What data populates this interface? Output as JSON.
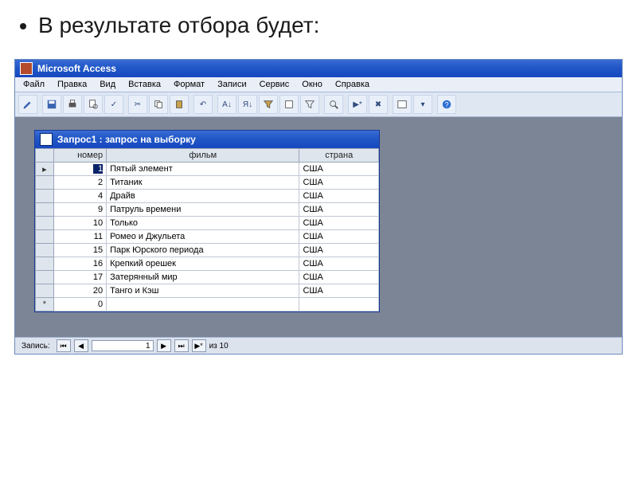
{
  "slide": {
    "bullet": "В результате отбора будет:"
  },
  "app": {
    "title": "Microsoft Access",
    "menu": [
      "Файл",
      "Правка",
      "Вид",
      "Вставка",
      "Формат",
      "Записи",
      "Сервис",
      "Окно",
      "Справка"
    ]
  },
  "toolbar_icons": [
    "design-view",
    "save",
    "print",
    "print-preview",
    "spelling",
    "cut",
    "copy",
    "paste",
    "undo",
    "sort-asc",
    "sort-desc",
    "filter-by-selection",
    "filter-by-form",
    "apply-filter",
    "find",
    "new-record",
    "delete-record",
    "database-window",
    "new-object",
    "help"
  ],
  "child": {
    "title": "Запрос1 : запрос на выборку"
  },
  "columns": {
    "num": "номер",
    "film": "фильм",
    "country": "страна"
  },
  "rows": [
    {
      "num": 1,
      "film": "Пятый элемент",
      "country": "США"
    },
    {
      "num": 2,
      "film": "Титаник",
      "country": "США"
    },
    {
      "num": 4,
      "film": "Драйв",
      "country": "США"
    },
    {
      "num": 9,
      "film": "Патруль времени",
      "country": "США"
    },
    {
      "num": 10,
      "film": "Только",
      "country": "США"
    },
    {
      "num": 11,
      "film": "Ромео и Джульета",
      "country": "США"
    },
    {
      "num": 15,
      "film": " Парк Юрского периода",
      "country": "США"
    },
    {
      "num": 16,
      "film": "Крепкий орешек",
      "country": "США"
    },
    {
      "num": 17,
      "film": "Затерянный мир",
      "country": "США"
    },
    {
      "num": 20,
      "film": "Танго и Кэш",
      "country": "США"
    }
  ],
  "new_row_num": 0,
  "nav": {
    "label": "Запись:",
    "current": "1",
    "total": "из  10",
    "first": "⏮",
    "prev": "◀",
    "next": "▶",
    "last": "⏭",
    "new": "▶*"
  }
}
